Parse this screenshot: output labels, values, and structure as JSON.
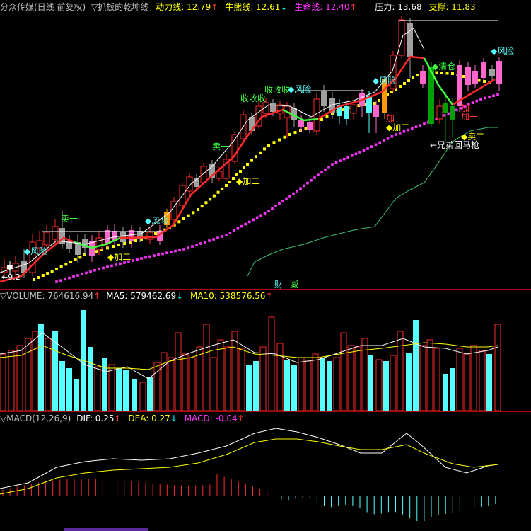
{
  "colors": {
    "up": "#ff2a2a",
    "down": "#00ffff",
    "flat": "#ffffff",
    "white": "#ffffff",
    "yellow": "#ffff00",
    "magenta": "#ff33ff",
    "green": "#40ff40",
    "cyan": "#55ffff",
    "pink": "#ff66cc",
    "gray": "#a0a0a0",
    "orange": "#ff9900",
    "darkgreen": "#00a000",
    "sep": "#b40000"
  },
  "header": {
    "stock": "分众传媒(日线 前复权)",
    "indicator": "▽抓板的乾坤线",
    "power_label": "动力线: 12.79",
    "power_arrow": "↑",
    "bull_label": "牛熊线: 12.61",
    "bull_arrow": "↓",
    "life_label": "生命线: 12.40",
    "life_arrow": "↑",
    "pressure_label": "压力: 13.68",
    "support_label": "支撑: 11.83"
  },
  "volume_header": {
    "volume": "▽VOLUME: 764616.94",
    "volume_arrow": "↑",
    "ma5": "MA5: 579462.69",
    "ma5_arrow": "↓",
    "ma10": "MA10: 538576.56",
    "ma10_arrow": "↑"
  },
  "macd_header": {
    "macd": "▽MACD(12,26,9)",
    "dif": "DIF: 0.25",
    "dif_arrow": "↑",
    "dea": "DEA: 0.27",
    "dea_arrow": "↓",
    "macdv": "MACD: -0.04",
    "macdv_arrow": "↑"
  },
  "annotations": {
    "sell1_a": "卖一",
    "risk_a": "风险",
    "add2_a": "加二",
    "risk_b": "风险",
    "sell1_b": "卖一",
    "add2_b": "加二",
    "shou": "收收收",
    "shou2": "收收收",
    "risk_c": "风险",
    "risk_d": "风险",
    "add1_a": "加一",
    "add2_c": "加二",
    "clear": "清仓",
    "add1_b": "加一",
    "add1_c": "加一",
    "sell2": "卖二",
    "risk_e": "风险",
    "brothers": "←兄弟回马枪",
    "left_val": "←9.2",
    "finance": "财",
    "reduce": "减"
  }
}
